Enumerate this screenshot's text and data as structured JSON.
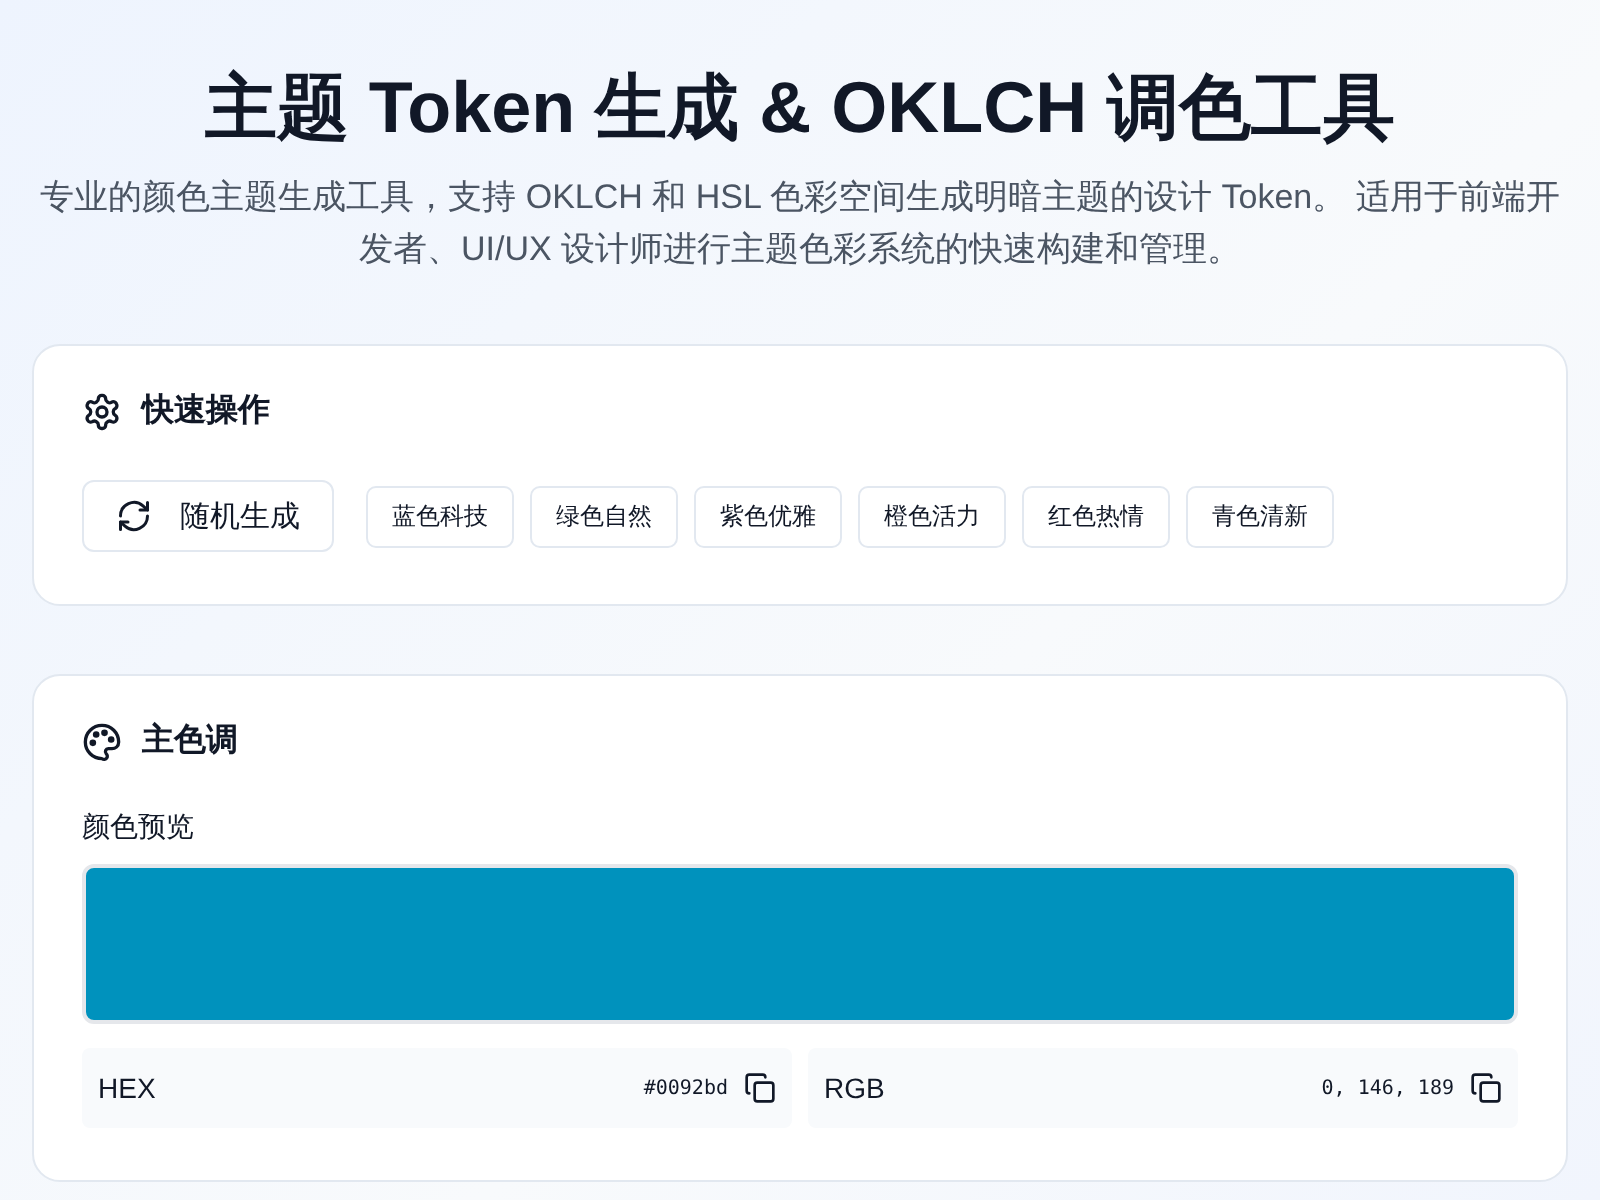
{
  "header": {
    "title": "主题 Token 生成 & OKLCH 调色工具",
    "subtitle": "专业的颜色主题生成工具，支持 OKLCH 和 HSL 色彩空间生成明暗主题的设计 Token。 适用于前端开发者、UI/UX 设计师进行主题色彩系统的快速构建和管理。"
  },
  "quick_actions": {
    "title": "快速操作",
    "random_button": "随机生成",
    "presets": [
      {
        "label": "蓝色科技"
      },
      {
        "label": "绿色自然"
      },
      {
        "label": "紫色优雅"
      },
      {
        "label": "橙色活力"
      },
      {
        "label": "红色热情"
      },
      {
        "label": "青色清新"
      }
    ]
  },
  "primary": {
    "title": "主色调",
    "preview_label": "颜色预览",
    "color": "#0092bd",
    "values": [
      {
        "label": "HEX",
        "value": "#0092bd"
      },
      {
        "label": "RGB",
        "value": "0, 146, 189"
      }
    ]
  }
}
